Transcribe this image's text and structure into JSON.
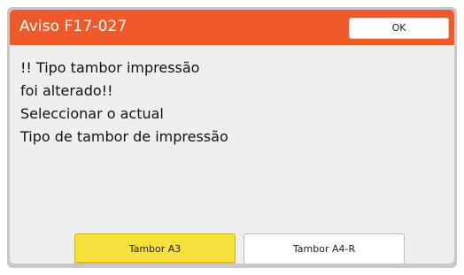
{
  "dialog": {
    "title": "Aviso F17-027",
    "ok_label": "OK",
    "message_lines": [
      "!! Tipo tambor impressão",
      "foi alterado!!",
      "Seleccionar o actual",
      "Tipo de tambor de impressão"
    ],
    "choices": [
      {
        "label": "Tambor A3",
        "selected": true
      },
      {
        "label": "Tambor A4-R",
        "selected": false
      }
    ]
  },
  "colors": {
    "title_bar": "#f05a2a",
    "selected_button": "#f5e03c",
    "dialog_background": "#efefef"
  }
}
